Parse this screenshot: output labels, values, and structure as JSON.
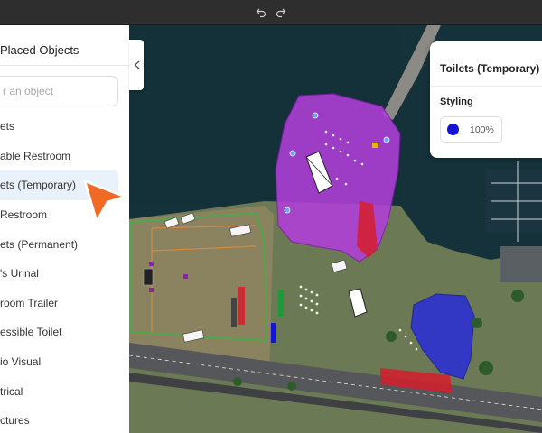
{
  "toolbar": {
    "undo_icon": "undo-icon",
    "redo_icon": "redo-icon"
  },
  "panel": {
    "title": "Placed Objects",
    "search_placeholder": "r an object",
    "items": [
      {
        "label": "ets"
      },
      {
        "label": "able Restroom"
      },
      {
        "label": "ets (Temporary)"
      },
      {
        "label": "Restroom"
      },
      {
        "label": "ets (Permanent)"
      },
      {
        "label": "'s Urinal"
      },
      {
        "label": "room Trailer"
      },
      {
        "label": "essible Toilet"
      },
      {
        "label": "io Visual"
      },
      {
        "label": "trical"
      },
      {
        "label": "ctures"
      }
    ],
    "selected_index": 2
  },
  "card": {
    "title": "Toilets (Temporary)",
    "section": "Styling",
    "color": "#1414d6",
    "opacity": "100%"
  },
  "colors": {
    "accent_purple": "#b13ed9",
    "accent_blue": "#2c2fd4",
    "accent_red": "#d61d2c",
    "cursor_orange": "#f06a25"
  },
  "icons": [
    "undo-icon",
    "redo-icon",
    "chevron-left-icon",
    "cursor-arrow-icon",
    "color-swatch-icon"
  ]
}
